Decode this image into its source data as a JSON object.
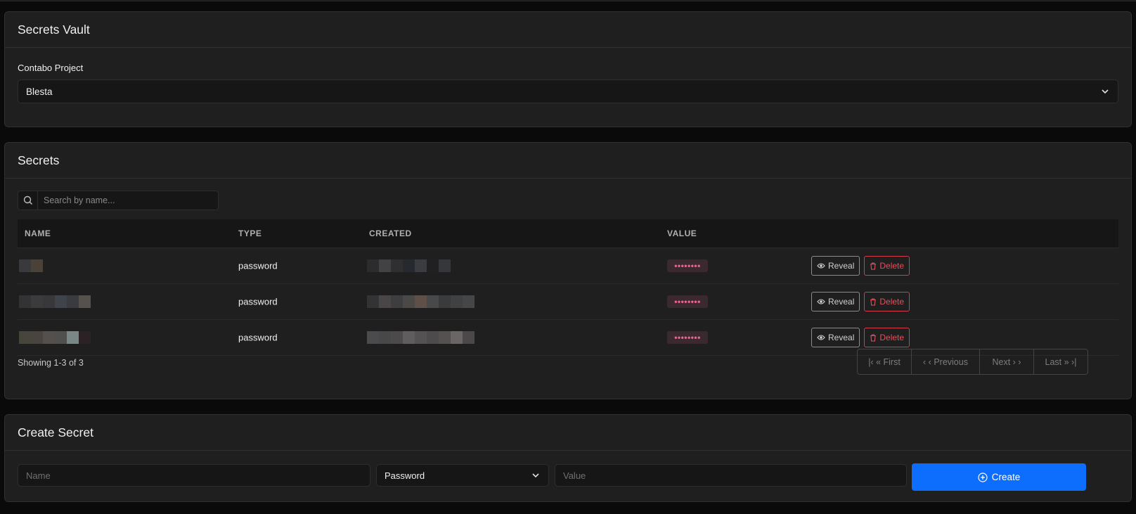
{
  "vault": {
    "title": "Secrets Vault",
    "project_label": "Contabo Project",
    "project_value": "Blesta"
  },
  "secrets": {
    "title": "Secrets",
    "search_placeholder": "Search by name...",
    "columns": {
      "name": "NAME",
      "type": "TYPE",
      "created": "CREATED",
      "value": "VALUE"
    },
    "rows": [
      {
        "type": "password",
        "value_mask": "••••••••",
        "reveal": "Reveal",
        "delete": "Delete"
      },
      {
        "type": "password",
        "value_mask": "••••••••",
        "reveal": "Reveal",
        "delete": "Delete"
      },
      {
        "type": "password",
        "value_mask": "••••••••",
        "reveal": "Reveal",
        "delete": "Delete"
      }
    ],
    "showing": "Showing 1-3 of 3",
    "pager": {
      "first": "|‹ « First",
      "previous": "‹ ‹ Previous",
      "next": "Next › ›",
      "last": "Last » ›|"
    }
  },
  "create": {
    "title": "Create Secret",
    "name_placeholder": "Name",
    "type_value": "Password",
    "value_placeholder": "Value",
    "create_label": "Create"
  },
  "colors": {
    "accent": "#0d6efd",
    "danger": "#d63c47",
    "mask": "#f06292"
  }
}
